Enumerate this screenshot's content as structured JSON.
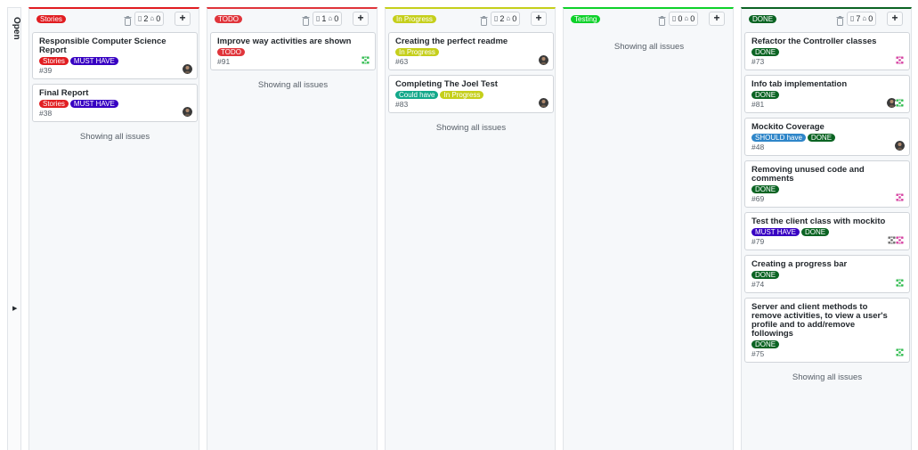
{
  "sidebar": {
    "label": "Open"
  },
  "columns": [
    {
      "name": "Stories",
      "color": "#e11d21",
      "cards_count": "2",
      "notes_count": "0",
      "footer": "Showing all issues",
      "cards": [
        {
          "title": "Responsible Computer Science Report",
          "number": "#39",
          "labels": [
            {
              "text": "Stories",
              "color": "#e11d21"
            },
            {
              "text": "MUST HAVE",
              "color": "#3700c2"
            }
          ],
          "avatars": [
            "photo"
          ]
        },
        {
          "title": "Final Report",
          "number": "#38",
          "labels": [
            {
              "text": "Stories",
              "color": "#e11d21"
            },
            {
              "text": "MUST HAVE",
              "color": "#3700c2"
            }
          ],
          "avatars": [
            "photo"
          ]
        }
      ]
    },
    {
      "name": "TODO",
      "color": "#e0353b",
      "cards_count": "1",
      "notes_count": "0",
      "footer": "Showing all issues",
      "cards": [
        {
          "title": "Improve way activities are shown",
          "number": "#91",
          "labels": [
            {
              "text": "TODO",
              "color": "#e0353b"
            }
          ],
          "avatars": [
            "green-identicon"
          ]
        }
      ]
    },
    {
      "name": "In Progress",
      "color": "#c5cf1b",
      "cards_count": "2",
      "notes_count": "0",
      "footer": "Showing all issues",
      "cards": [
        {
          "title": "Creating the perfect readme",
          "number": "#63",
          "labels": [
            {
              "text": "In Progress",
              "color": "#c5cf1b"
            }
          ],
          "avatars": [
            "photo"
          ]
        },
        {
          "title": "Completing The Joel Test",
          "number": "#83",
          "labels": [
            {
              "text": "Could have",
              "color": "#12a88a"
            },
            {
              "text": "In Progress",
              "color": "#c5cf1b"
            }
          ],
          "avatars": [
            "photo"
          ]
        }
      ]
    },
    {
      "name": "Testing",
      "color": "#0ed12a",
      "cards_count": "0",
      "notes_count": "0",
      "footer": "Showing all issues",
      "cards": []
    },
    {
      "name": "DONE",
      "color": "#0b6423",
      "cards_count": "7",
      "notes_count": "0",
      "footer": "Showing all issues",
      "cards": [
        {
          "title": "Refactor the Controller classes",
          "number": "#73",
          "labels": [
            {
              "text": "DONE",
              "color": "#0b6423"
            }
          ],
          "avatars": [
            "pink-identicon"
          ]
        },
        {
          "title": "Info tab implementation",
          "number": "#81",
          "labels": [
            {
              "text": "DONE",
              "color": "#0b6423"
            }
          ],
          "avatars": [
            "photo",
            "green-identicon"
          ]
        },
        {
          "title": "Mockito Coverage",
          "number": "#48",
          "labels": [
            {
              "text": "SHOULD have",
              "color": "#2f86c9"
            },
            {
              "text": "DONE",
              "color": "#0b6423"
            }
          ],
          "avatars": [
            "photo"
          ]
        },
        {
          "title": "Removing unused code and comments",
          "number": "#69",
          "labels": [
            {
              "text": "DONE",
              "color": "#0b6423"
            }
          ],
          "avatars": [
            "pink-identicon"
          ]
        },
        {
          "title": "Test the client class with mockito",
          "number": "#79",
          "labels": [
            {
              "text": "MUST HAVE",
              "color": "#3700c2"
            },
            {
              "text": "DONE",
              "color": "#0b6423"
            }
          ],
          "avatars": [
            "grey-identicon",
            "pink-identicon"
          ]
        },
        {
          "title": "Creating a progress bar",
          "number": "#74",
          "labels": [
            {
              "text": "DONE",
              "color": "#0b6423"
            }
          ],
          "avatars": [
            "green-identicon"
          ]
        },
        {
          "title": "Server and client methods to remove activities, to view a user's profile and to add/remove followings",
          "number": "#75",
          "labels": [
            {
              "text": "DONE",
              "color": "#0b6423"
            }
          ],
          "avatars": [
            "green-identicon"
          ]
        }
      ]
    }
  ]
}
